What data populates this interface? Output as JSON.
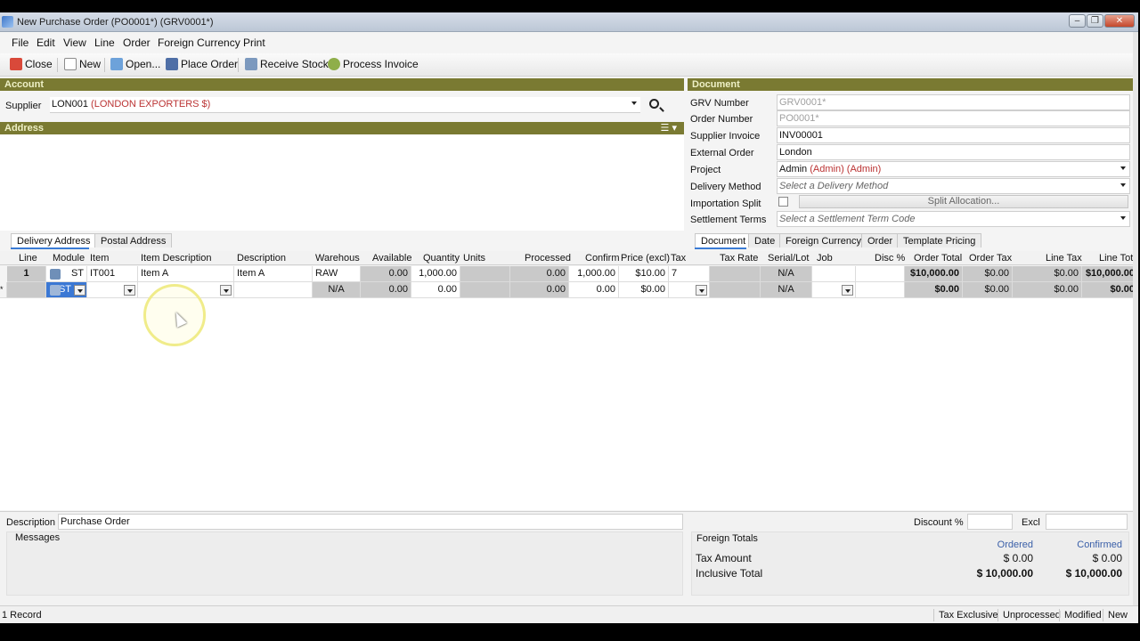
{
  "window": {
    "title": "New Purchase Order (PO0001*) (GRV0001*)",
    "buttons": [
      "‒",
      "❐",
      "✕"
    ]
  },
  "menu": [
    "File",
    "Edit",
    "View",
    "Line",
    "Order",
    "Foreign Currency",
    "Print"
  ],
  "toolbar": {
    "close": "Close",
    "new": "New",
    "open": "Open...",
    "place_order": "Place Order",
    "receive_stock": "Receive Stock",
    "process_invoice": "Process Invoice"
  },
  "account": {
    "section": "Account",
    "supplier_label": "Supplier",
    "supplier_code": "LON001",
    "supplier_name": "(LONDON EXPORTERS $)",
    "address_section": "Address"
  },
  "document": {
    "section": "Document",
    "fields": [
      {
        "label": "GRV Number",
        "value": "GRV0001*"
      },
      {
        "label": "Order Number",
        "value": "PO0001*"
      },
      {
        "label": "Supplier Invoice",
        "value": "INV00001"
      },
      {
        "label": "External Order",
        "value": "London"
      },
      {
        "label": "Project",
        "value_code": "Admin",
        "value_rest": "(Admin) (Admin)"
      },
      {
        "label": "Delivery Method",
        "placeholder": "Select a Delivery Method"
      },
      {
        "label": "Importation Split"
      },
      {
        "label": "Settlement Terms",
        "placeholder": "Select a Settlement Term Code"
      }
    ],
    "split_button": "Split Allocation..."
  },
  "left_tabs": [
    "Delivery Address",
    "Postal Address"
  ],
  "right_tabs": [
    "Document",
    "Date",
    "Foreign Currency",
    "Order",
    "Template Pricing"
  ],
  "grid": {
    "columns": [
      "Line",
      "Module",
      "Item",
      "Item Description",
      "Description",
      "Warehous",
      "Available",
      "Quantity",
      "Units",
      "Processed",
      "Confirm",
      "Price (excl)",
      "Tax",
      "Tax Rate",
      "Serial/Lot",
      "Job",
      "Disc %",
      "Order Total",
      "Order Tax",
      "Line Tax",
      "Line Total"
    ],
    "rows": [
      {
        "line": "1",
        "module": "ST",
        "item": "IT001",
        "item_description": "Item A",
        "description": "Item A",
        "warehouse": "RAW",
        "available": "0.00",
        "quantity": "1,000.00",
        "units": "",
        "processed": "0.00",
        "confirm": "1,000.00",
        "price": "$10.00",
        "tax": "7",
        "tax_rate": "",
        "serial": "N/A",
        "job": "",
        "disc": "",
        "order_total": "$10,000.00",
        "order_tax": "$0.00",
        "line_tax": "$0.00",
        "line_total": "$10,000.00"
      },
      {
        "line": "*",
        "module": "ST",
        "item": "",
        "item_description": "",
        "description": "",
        "warehouse": "N/A",
        "available": "0.00",
        "quantity": "0.00",
        "units": "",
        "processed": "0.00",
        "confirm": "0.00",
        "price": "$0.00",
        "tax": "",
        "tax_rate": "",
        "serial": "N/A",
        "job": "",
        "disc": "",
        "order_total": "$0.00",
        "order_tax": "$0.00",
        "line_tax": "$0.00",
        "line_total": "$0.00"
      }
    ]
  },
  "footer": {
    "description_label": "Description",
    "description_value": "Purchase Order",
    "discount_label": "Discount %",
    "excl_label": "Excl",
    "messages_label": "Messages",
    "foreign_totals": "Foreign Totals",
    "ordered_label": "Ordered",
    "confirmed_label": "Confirmed",
    "tax_amount_label": "Tax Amount",
    "tax_ordered": "$ 0.00",
    "tax_confirmed": "$ 0.00",
    "inclusive_label": "Inclusive Total",
    "incl_ordered": "$ 10,000.00",
    "incl_confirmed": "$ 10,000.00"
  },
  "status": {
    "records": "1 Record",
    "tax_mode": "Tax Exclusive",
    "state": "Unprocessed",
    "modified": "Modified",
    "new": "New"
  }
}
